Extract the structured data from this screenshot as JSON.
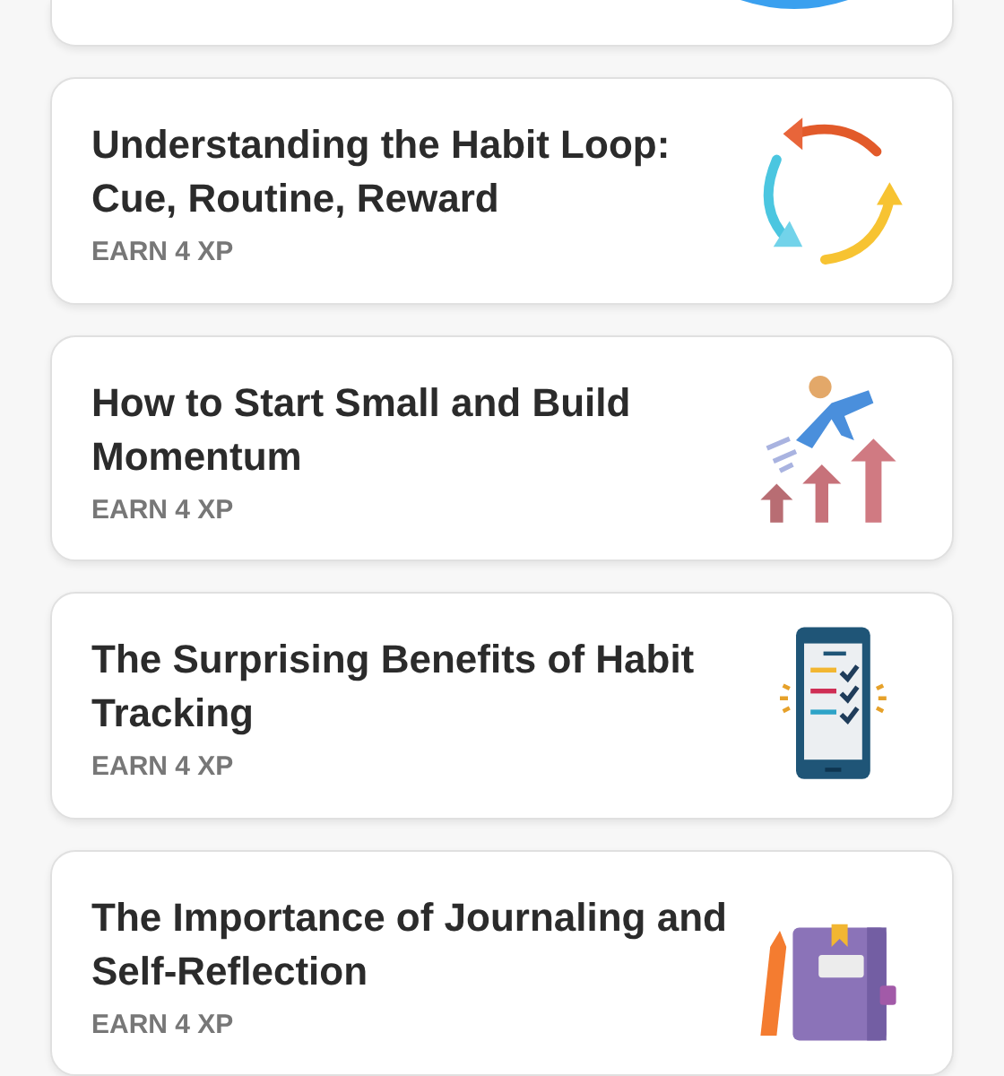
{
  "lessons": [
    {
      "title": "Understanding the Habit Loop: Cue, Routine, Reward",
      "reward": "EARN 4 XP"
    },
    {
      "title": "How to Start Small and Build Momentum",
      "reward": "EARN 4 XP"
    },
    {
      "title": "The Surprising Benefits of Habit Tracking",
      "reward": "EARN 4 XP"
    },
    {
      "title": "The Importance of Journaling and Self-Reflection",
      "reward": "EARN 4 XP"
    }
  ]
}
